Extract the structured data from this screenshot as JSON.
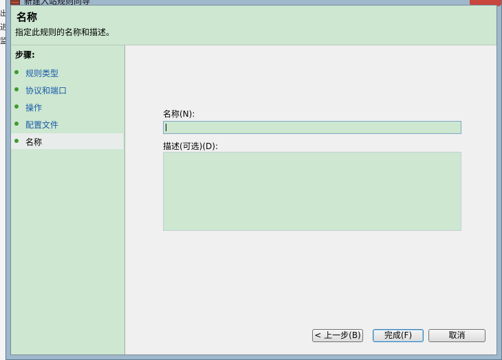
{
  "window": {
    "title": "新建入站规则向导"
  },
  "background": {
    "chars": [
      "出",
      "进",
      "监"
    ]
  },
  "header": {
    "title": "名称",
    "description": "指定此规则的名称和描述。"
  },
  "steps": {
    "heading": "步骤:",
    "items": [
      {
        "label": "规则类型",
        "active": false
      },
      {
        "label": "协议和端口",
        "active": false
      },
      {
        "label": "操作",
        "active": false
      },
      {
        "label": "配置文件",
        "active": false
      },
      {
        "label": "名称",
        "active": true
      }
    ]
  },
  "form": {
    "name_label": "名称(N):",
    "name_value": "",
    "description_label": "描述(可选)(D):",
    "description_value": ""
  },
  "buttons": {
    "back": "< 上一步(B)",
    "finish": "完成(F)",
    "cancel": "取消"
  },
  "colors": {
    "panel_green": "#cde7d1",
    "link_blue": "#1a5aa8",
    "step_dot": "#3f9a2d"
  }
}
